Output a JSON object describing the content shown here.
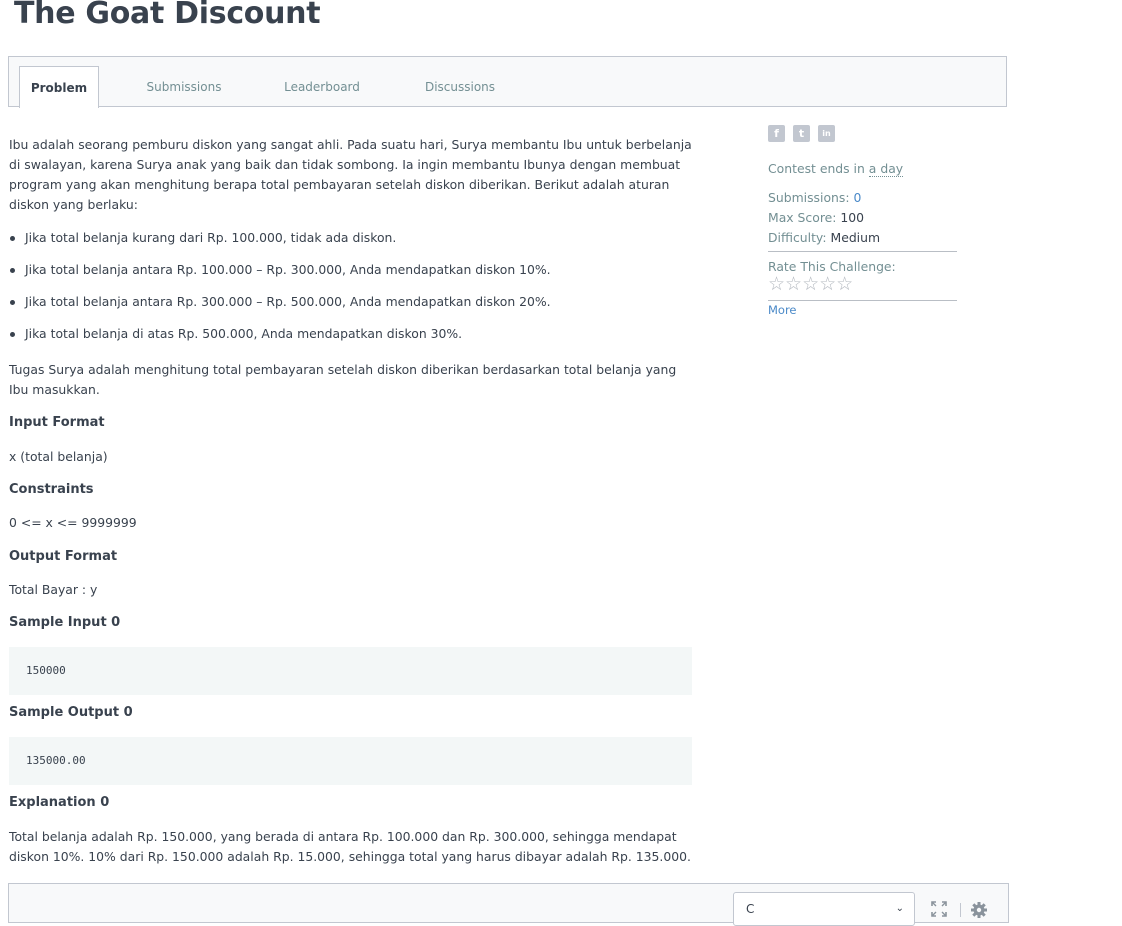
{
  "title": "The Goat Discount",
  "tabs": [
    "Problem",
    "Submissions",
    "Leaderboard",
    "Discussions"
  ],
  "problem": {
    "intro": "Ibu adalah seorang pemburu diskon yang sangat ahli. Pada suatu hari, Surya membantu Ibu untuk berbelanja di swalayan, karena Surya anak yang baik dan tidak sombong. Ia ingin membantu Ibunya dengan membuat program yang akan menghitung berapa total pembayaran setelah diskon diberikan. Berikut adalah aturan diskon yang berlaku:",
    "rules": [
      "Jika total belanja kurang dari Rp. 100.000, tidak ada diskon.",
      "Jika total belanja antara Rp. 100.000 – Rp. 300.000, Anda mendapatkan diskon 10%.",
      "Jika total belanja antara Rp. 300.000 – Rp. 500.000, Anda mendapatkan diskon 20%.",
      "Jika total belanja di atas Rp. 500.000, Anda mendapatkan diskon 30%."
    ],
    "task": "Tugas Surya adalah menghitung total pembayaran setelah diskon diberikan berdasarkan total belanja yang Ibu masukkan.",
    "input_format_label": "Input Format",
    "input_format": "x (total belanja)",
    "constraints_label": "Constraints",
    "constraints": "0 <= x <= 9999999",
    "output_format_label": "Output Format",
    "output_format": "Total Bayar : y",
    "sample_input_label": "Sample Input 0",
    "sample_input": "150000",
    "sample_output_label": "Sample Output 0",
    "sample_output": "135000.00",
    "explanation_label": "Explanation 0",
    "explanation": "Total belanja adalah Rp. 150.000, yang berada di antara Rp. 100.000 dan Rp. 300.000, sehingga mendapat diskon 10%. 10% dari Rp. 150.000 adalah Rp. 15.000, sehingga total yang harus dibayar adalah Rp. 135.000."
  },
  "sidebar": {
    "social": [
      "f",
      "t",
      "in"
    ],
    "contest_prefix": "Contest ends in ",
    "contest_value": "a day",
    "submissions_label": "Submissions:",
    "submissions_value": "0",
    "max_score_label": "Max Score:",
    "max_score_value": "100",
    "difficulty_label": "Difficulty:",
    "difficulty_value": "Medium",
    "rate_label": "Rate This Challenge:",
    "stars": "☆☆☆☆☆",
    "more_link": "More"
  },
  "editor": {
    "language": "C",
    "colors": {
      "accent": "#1ba94c",
      "link": "#4a89c8"
    }
  }
}
